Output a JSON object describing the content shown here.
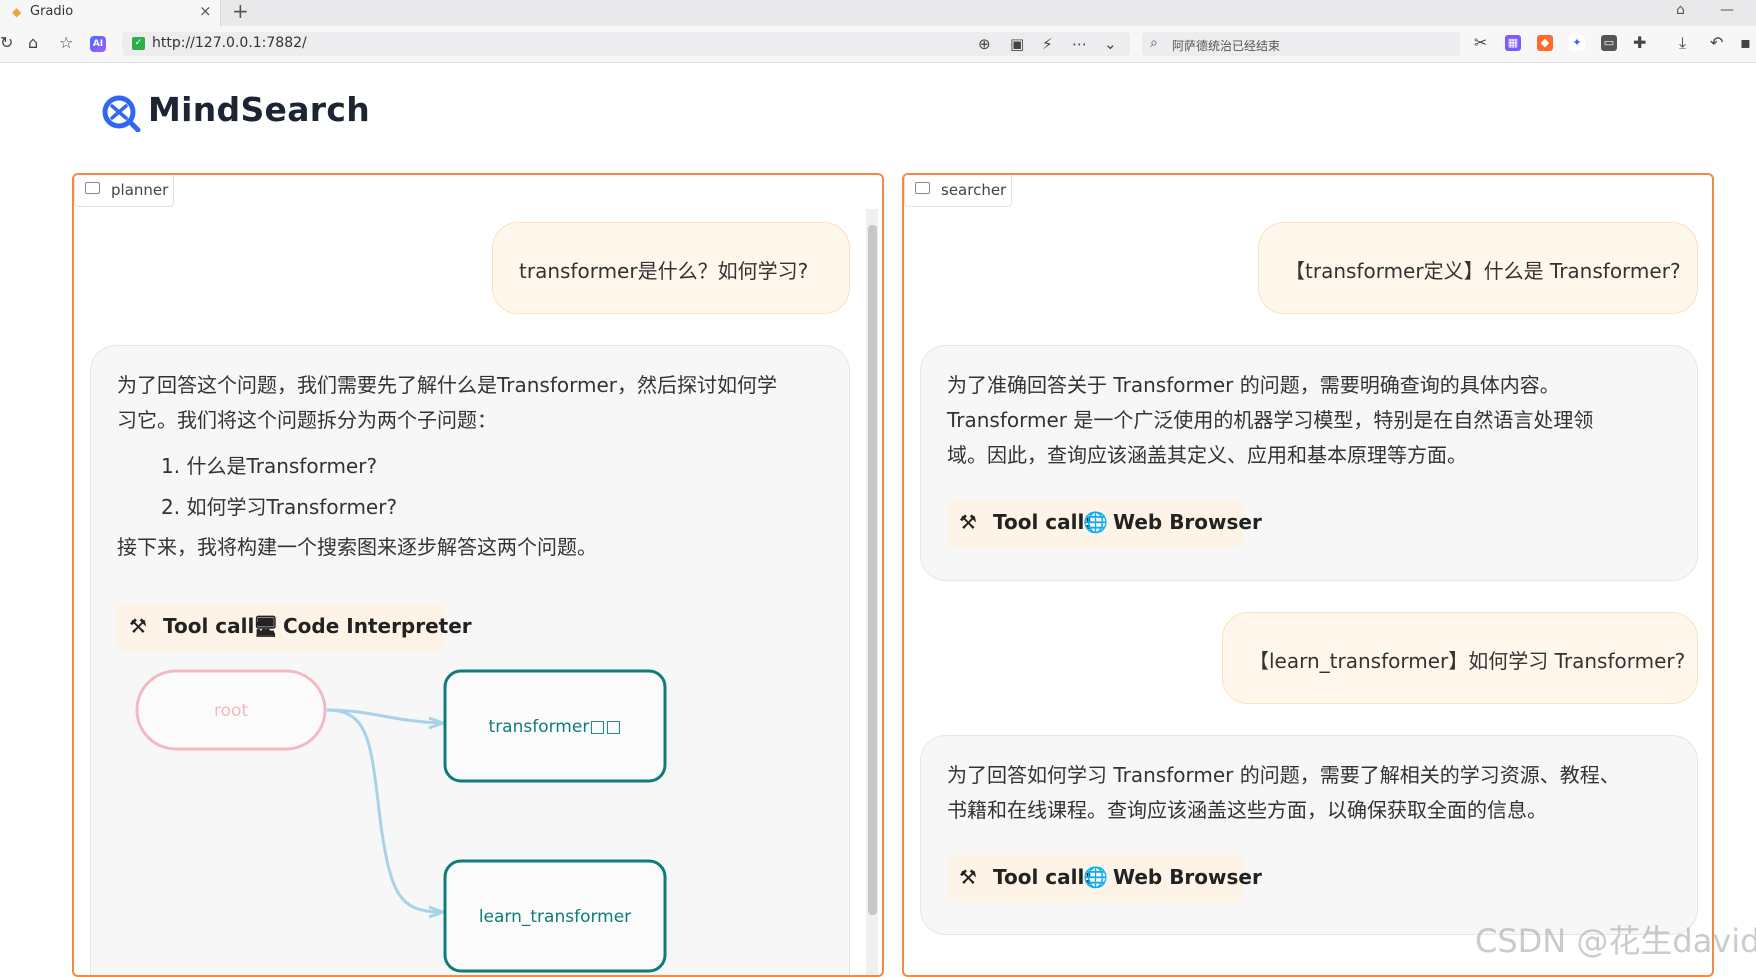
{
  "browser": {
    "tab_title": "Gradio",
    "url": "http://127.0.0.1:7882/",
    "search_placeholder": "阿萨德统治已经结束"
  },
  "app": {
    "name": "MindSearch"
  },
  "planner": {
    "label": "planner",
    "user_message": "transformer是什么？如何学习?",
    "bot_lines": [
      "为了回答这个问题，我们需要先了解什么是Transformer，然后探讨如何学",
      "习它。我们将这个问题拆分为两个子问题："
    ],
    "sub_questions": [
      "1. 什么是Transformer?",
      "2. 如何学习Transformer?"
    ],
    "closing": "接下来，我将构建一个搜索图来逐步解答这两个问题。",
    "tool_prefix": "Tool call:",
    "tool_name": "Code Interpreter",
    "graph": {
      "root": "root",
      "node_1": "transformer□□",
      "node_2": "learn_transformer"
    }
  },
  "searcher": {
    "label": "searcher",
    "q1": "【transformer定义】什么是 Transformer?",
    "a1_lines": [
      "为了准确回答关于 Transformer 的问题，需要明确查询的具体内容。",
      "Transformer 是一个广泛使用的机器学习模型，特别是在自然语言处理领",
      "域。因此，查询应该涵盖其定义、应用和基本原理等方面。"
    ],
    "q2": "【learn_transformer】如何学习 Transformer?",
    "a2_lines": [
      "为了回答如何学习 Transformer 的问题，需要了解相关的学习资源、教程、",
      "书籍和在线课程。查询应该涵盖这些方面，以确保获取全面的信息。"
    ],
    "tool_prefix": "Tool call:",
    "tool_name": "Web Browser"
  },
  "watermark": "CSDN @花生david",
  "colors": {
    "panel_border": "#f08a4b",
    "user_bubble": "#fff7ec",
    "bot_bubble": "#f7f7f7",
    "node_teal": "#0f7c78",
    "root_pink": "#f4b8c2",
    "edge_blue": "#a8d3e6"
  }
}
